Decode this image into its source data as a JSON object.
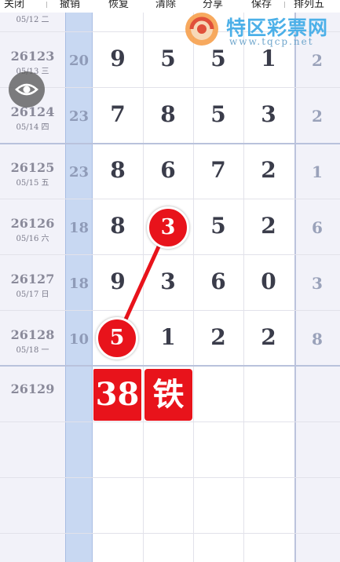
{
  "toolbar": {
    "items": [
      {
        "label": "关闭"
      },
      {
        "label": "撤销"
      },
      {
        "label": "恢复"
      },
      {
        "label": "清除"
      },
      {
        "label": "分享"
      },
      {
        "label": "保存"
      },
      {
        "label": "排列五"
      }
    ]
  },
  "watermark": {
    "title": "特区彩票网",
    "url": "www.tqcp.net"
  },
  "top_partial": {
    "date": "05/12 二"
  },
  "rows": [
    {
      "period": "26123",
      "date": "05/13 三",
      "sum": "20",
      "digits": [
        "9",
        "5",
        "5",
        "1"
      ],
      "span": "2"
    },
    {
      "period": "26124",
      "date": "05/14 四",
      "sum": "23",
      "digits": [
        "7",
        "8",
        "5",
        "3"
      ],
      "span": "2"
    },
    {
      "period": "26125",
      "date": "05/15 五",
      "sum": "23",
      "digits": [
        "8",
        "6",
        "7",
        "2"
      ],
      "span": "1"
    },
    {
      "period": "26126",
      "date": "05/16 六",
      "sum": "18",
      "digits": [
        "8",
        "3",
        "5",
        "2"
      ],
      "span": "6"
    },
    {
      "period": "26127",
      "date": "05/17 日",
      "sum": "18",
      "digits": [
        "9",
        "3",
        "6",
        "0"
      ],
      "span": "3"
    },
    {
      "period": "26128",
      "date": "05/18 一",
      "sum": "10",
      "digits": [
        "5",
        "1",
        "2",
        "2"
      ],
      "span": "8"
    }
  ],
  "next_row": {
    "period": "26129",
    "prediction": "38",
    "tag": "铁"
  },
  "highlights": [
    {
      "row": 3,
      "col": 1,
      "value": "3"
    },
    {
      "row": 5,
      "col": 0,
      "value": "5"
    }
  ],
  "colors": {
    "ball": "#e8131b",
    "sum_column": "#c8d8f2",
    "side_columns": "#f2f2f9"
  }
}
